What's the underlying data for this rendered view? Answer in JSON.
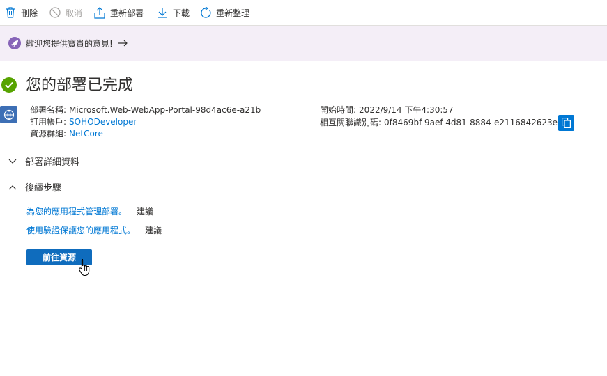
{
  "toolbar": {
    "delete_label": "刪除",
    "cancel_label": "取消",
    "redeploy_label": "重新部署",
    "download_label": "下載",
    "refresh_label": "重新整理"
  },
  "banner": {
    "text": "歡迎您提供寶貴的意見!"
  },
  "page": {
    "title": "您的部署已完成"
  },
  "deployment": {
    "name_key": "部署名稱:",
    "name_value": "Microsoft.Web-WebApp-Portal-98d4ac6e-a21b",
    "subscription_key": "訂用帳戶:",
    "subscription_value": "SOHODeveloper",
    "resource_group_key": "資源群組:",
    "resource_group_value": "NetCore",
    "start_time_key": "開始時間:",
    "start_time_value": "2022/9/14 下午4:30:57",
    "correlation_key": "相互關聯識別碼:",
    "correlation_value": "0f8469bf-9aef-4d81-8884-e2116842623e"
  },
  "sections": {
    "details_label": "部署詳細資料",
    "next_steps_label": "後續步驟"
  },
  "next_steps": [
    {
      "link": "為您的應用程式管理部署。",
      "tag": "建議"
    },
    {
      "link": "使用驗證保護您的應用程式。",
      "tag": "建議"
    }
  ],
  "primary_button": {
    "label": "前往資源"
  },
  "colors": {
    "accent": "#0078d4",
    "success": "#57a300",
    "banner_bg": "#f4eef7",
    "banner_icon": "#8764b8"
  }
}
